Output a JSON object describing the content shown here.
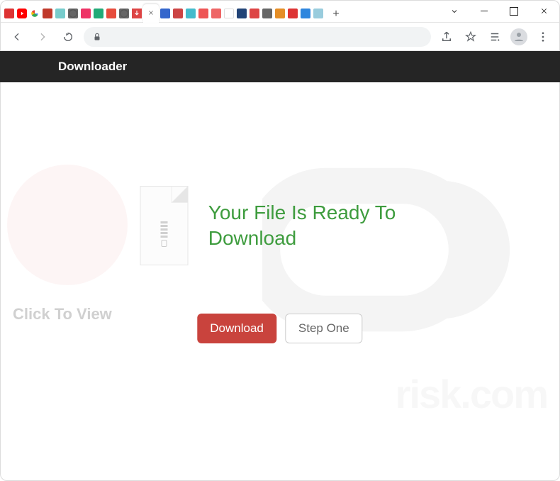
{
  "window": {
    "tabs": [
      {
        "id": "t1"
      },
      {
        "id": "t2"
      },
      {
        "id": "t3"
      },
      {
        "id": "t4"
      },
      {
        "id": "t5"
      },
      {
        "id": "t6"
      },
      {
        "id": "t7"
      },
      {
        "id": "t8"
      },
      {
        "id": "t9"
      },
      {
        "id": "t10"
      },
      {
        "id": "t11"
      },
      {
        "id": "t12",
        "active": true
      },
      {
        "id": "t13"
      },
      {
        "id": "t14"
      },
      {
        "id": "t15"
      },
      {
        "id": "t16"
      },
      {
        "id": "t17"
      },
      {
        "id": "t18"
      },
      {
        "id": "t19"
      },
      {
        "id": "t20"
      },
      {
        "id": "t21"
      },
      {
        "id": "t22"
      },
      {
        "id": "t23"
      },
      {
        "id": "t24"
      },
      {
        "id": "t25"
      }
    ]
  },
  "address_bar": {
    "url": ""
  },
  "page_header": {
    "title": "Downloader"
  },
  "content": {
    "headline": "Your File Is Ready To Download",
    "buttons": {
      "primary": "Download",
      "secondary": "Step One"
    }
  },
  "watermark": {
    "side_text": "Click To View",
    "risk_text": "risk.com"
  },
  "colors": {
    "header_bg": "#252525",
    "headline": "#3e9c3e",
    "primary_btn": "#c9433d"
  }
}
